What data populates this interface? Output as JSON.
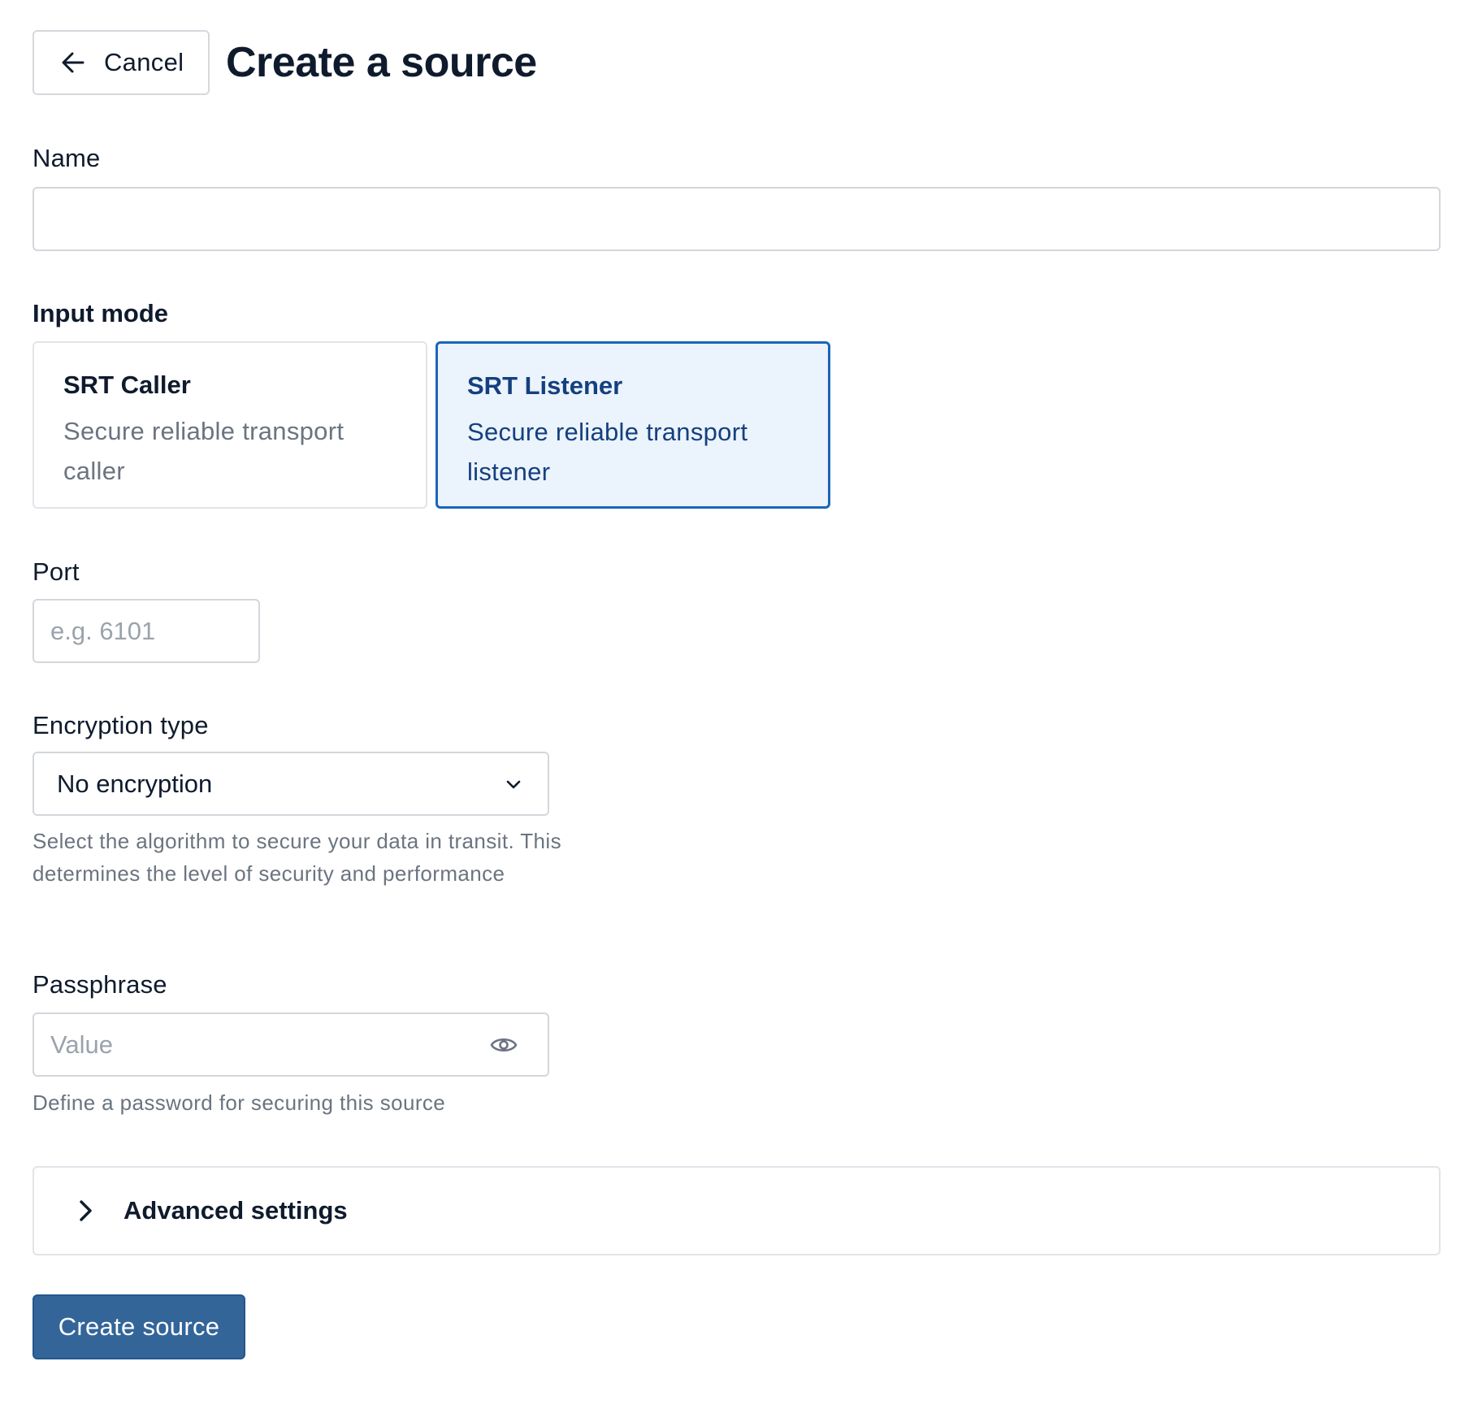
{
  "header": {
    "cancel_label": "Cancel",
    "cancel_icon": "arrow-left-icon",
    "title": "Create a source"
  },
  "form": {
    "name": {
      "label": "Name",
      "value": "",
      "placeholder": ""
    },
    "input_mode": {
      "label": "Input mode",
      "selected": "SRT Listener",
      "options": [
        {
          "title": "SRT Caller",
          "description": "Secure reliable transport caller",
          "selected": false
        },
        {
          "title": "SRT Listener",
          "description": "Secure reliable transport listener",
          "selected": true
        }
      ]
    },
    "port": {
      "label": "Port",
      "value": "",
      "placeholder": "e.g. 6101"
    },
    "encryption": {
      "label": "Encryption type",
      "value": "No encryption",
      "help": "Select the algorithm to secure your data in transit. This determines the level of security and performance",
      "icon": "chevron-down-icon"
    },
    "passphrase": {
      "label": "Passphrase",
      "value": "",
      "placeholder": "Value",
      "help": "Define a password for securing this source",
      "icon": "eye-icon"
    },
    "advanced": {
      "label": "Advanced settings",
      "expanded": false,
      "icon": "chevron-right-icon"
    },
    "submit_label": "Create source"
  },
  "colors": {
    "text_primary": "#0f1b2d",
    "text_secondary": "#6b7480",
    "selected_border": "#1b65b8",
    "selected_bg": "#ebf3fc",
    "selected_text": "#14407f",
    "primary_button": "#336599"
  }
}
